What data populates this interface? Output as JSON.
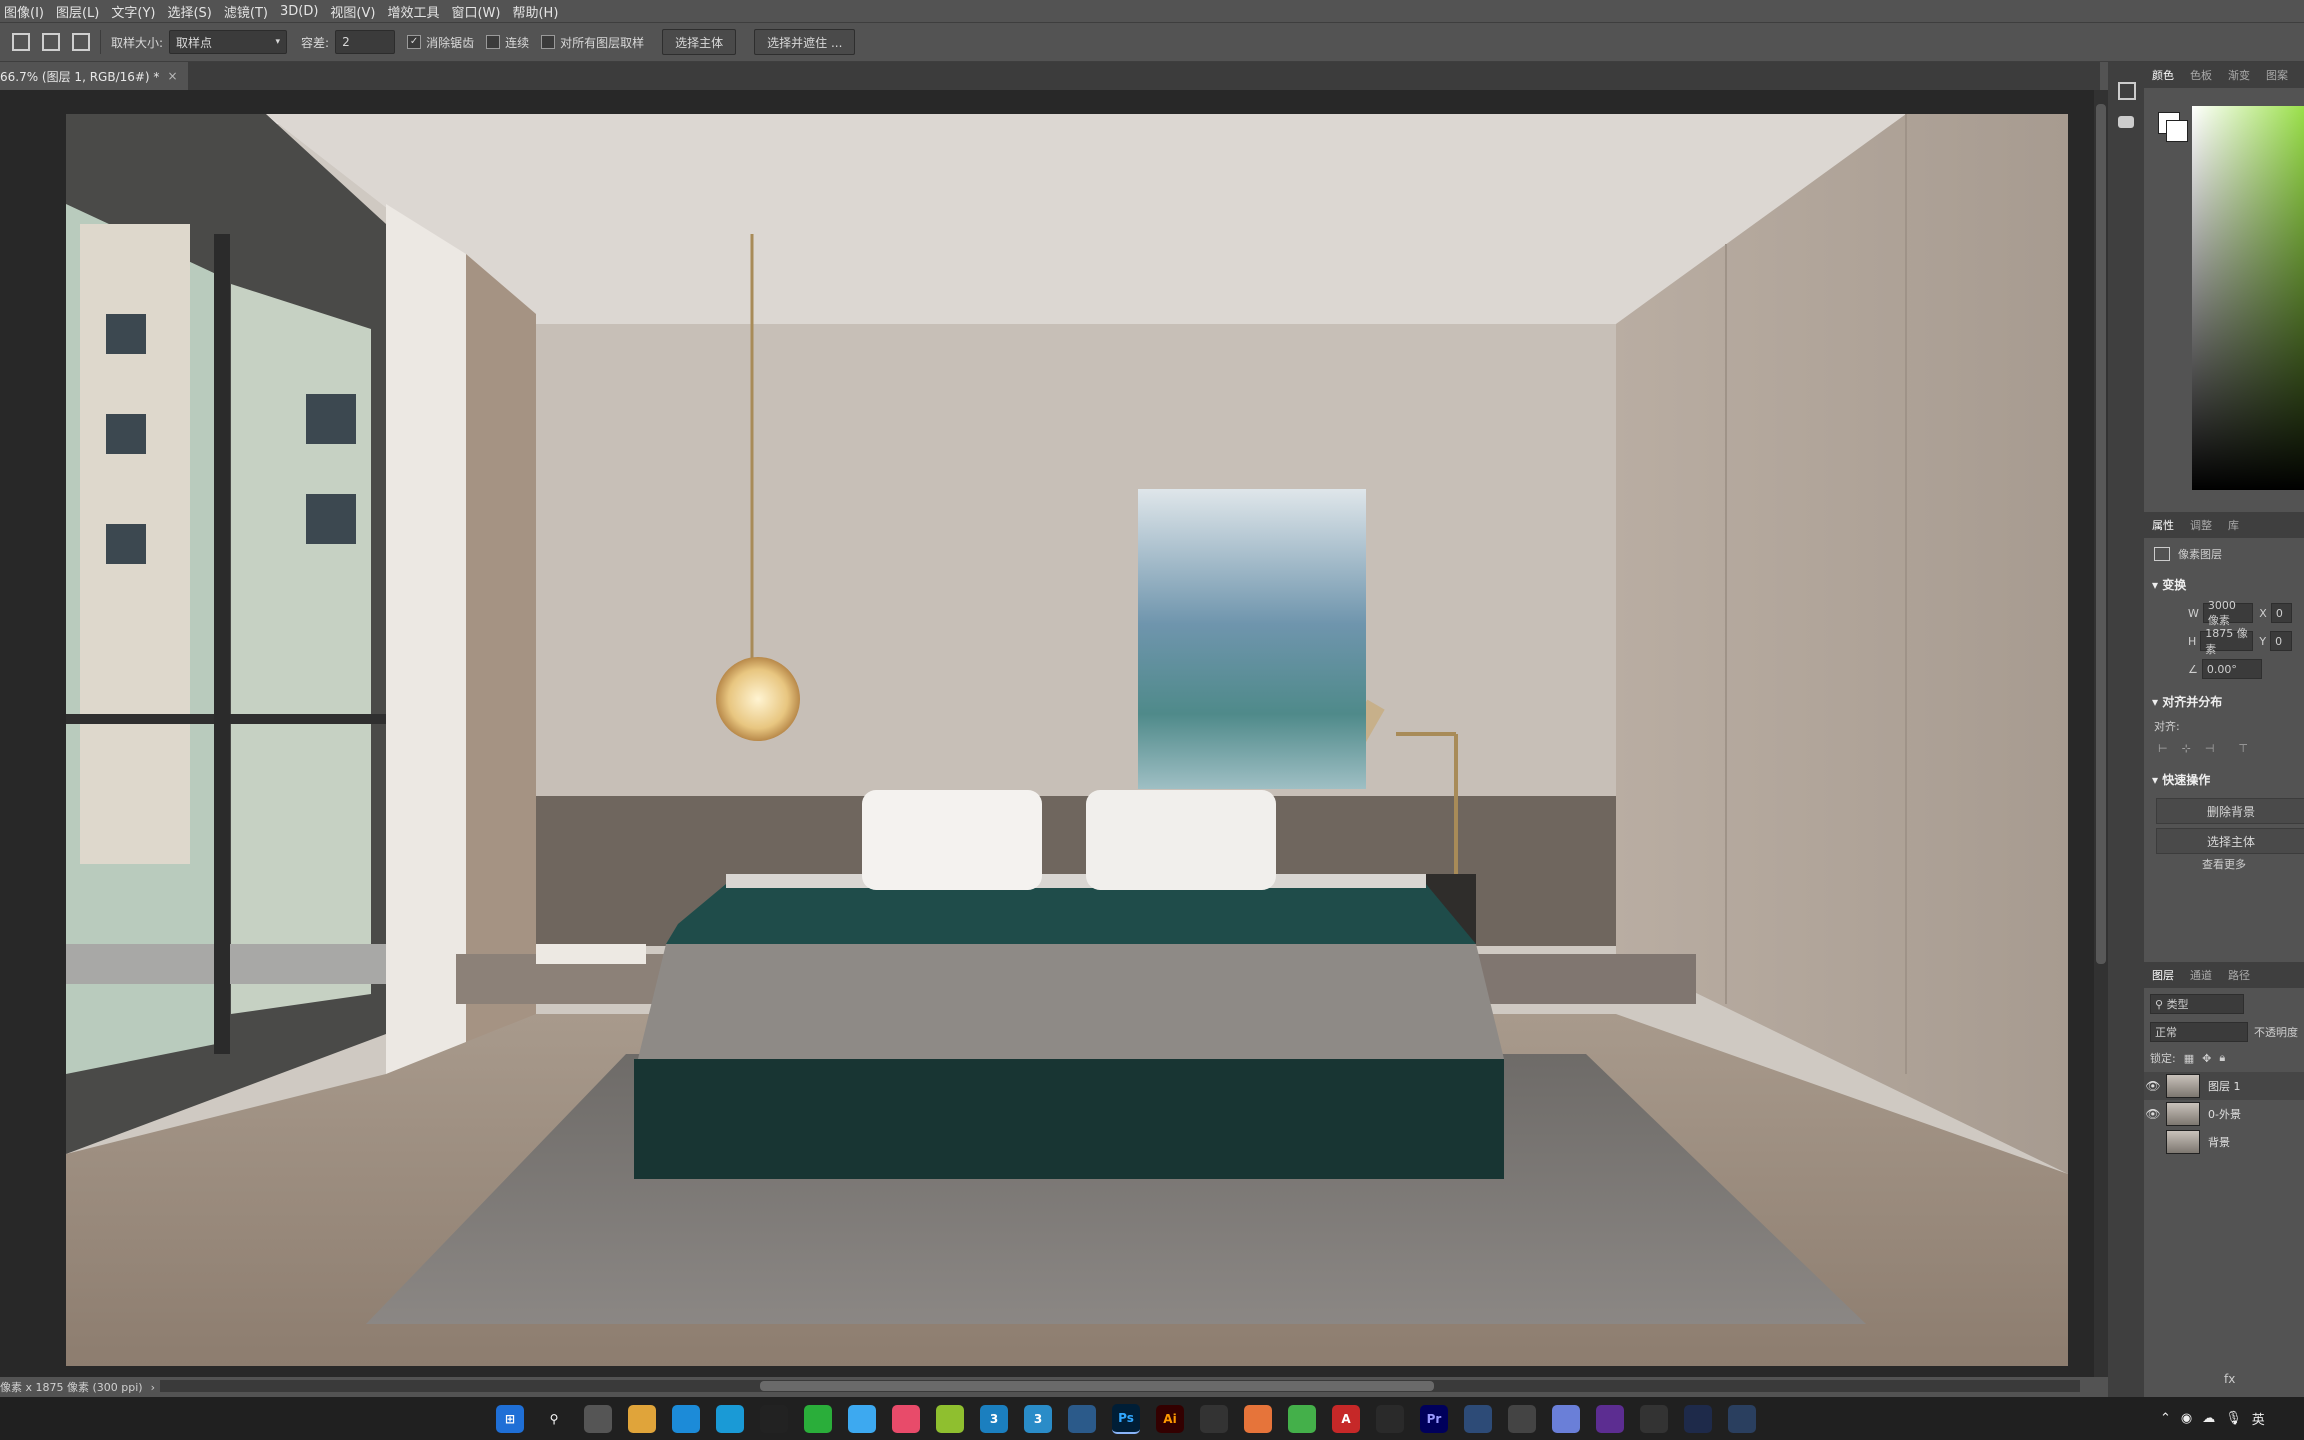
{
  "colors": {
    "ui_bg": "#535353",
    "dark_bg": "#282828",
    "taskbar": "#202020"
  },
  "menubar": {
    "items": [
      "图像(I)",
      "图层(L)",
      "文字(Y)",
      "选择(S)",
      "滤镜(T)",
      "3D(D)",
      "视图(V)",
      "增效工具",
      "窗口(W)",
      "帮助(H)"
    ]
  },
  "options": {
    "sample_size_label": "取样大小:",
    "sample_size_value": "取样点",
    "tolerance_label": "容差:",
    "tolerance_value": "2",
    "antialias_label": "消除锯齿",
    "antialias_checked": "✓",
    "contiguous_label": "连续",
    "all_layers_label": "对所有图层取样",
    "select_subject": "选择主体",
    "select_and_mask": "选择并遮住 ..."
  },
  "document": {
    "tab_title": "66.7% (图层 1, RGB/16#) *",
    "tab_close": "×"
  },
  "status": {
    "info": "像素 x 1875 像素 (300 ppi)",
    "arrow": "›"
  },
  "right_panel": {
    "color_tabs": [
      "颜色",
      "色板",
      "渐变",
      "图案"
    ],
    "properties_tabs": [
      "属性",
      "调整",
      "库"
    ],
    "pixel_layer": "像素图层",
    "transform_title": "变换",
    "w_label": "W",
    "w_value": "3000 像素",
    "x_label": "X",
    "x_value": "0",
    "h_label": "H",
    "h_value": "1875 像素",
    "y_label": "Y",
    "y_value": "0",
    "angle_value": "0.00°",
    "align_title": "对齐并分布",
    "align_label": "对齐:",
    "quick_title": "快速操作",
    "remove_bg": "删除背景",
    "select_subject": "选择主体",
    "more": "查看更多",
    "layers_tabs": [
      "图层",
      "通道",
      "路径"
    ],
    "filter_kind": "类型",
    "blend_mode": "正常",
    "opacity_label": "不透明度",
    "lock_label": "锁定:",
    "layers": [
      {
        "name": "图层 1"
      },
      {
        "name": "0-外景"
      },
      {
        "name": "背景"
      }
    ]
  },
  "taskbar": {
    "apps": [
      {
        "label": "3",
        "color": "#1b7fbf"
      },
      {
        "label": "3",
        "color": "#2a8cc8"
      },
      {
        "label": "Ps",
        "color": "#001e36"
      },
      {
        "label": "Ai",
        "color": "#330000"
      },
      {
        "label": "A",
        "color": "#c62828"
      },
      {
        "label": "Pr",
        "color": "#00005b"
      }
    ],
    "ime": "英"
  }
}
